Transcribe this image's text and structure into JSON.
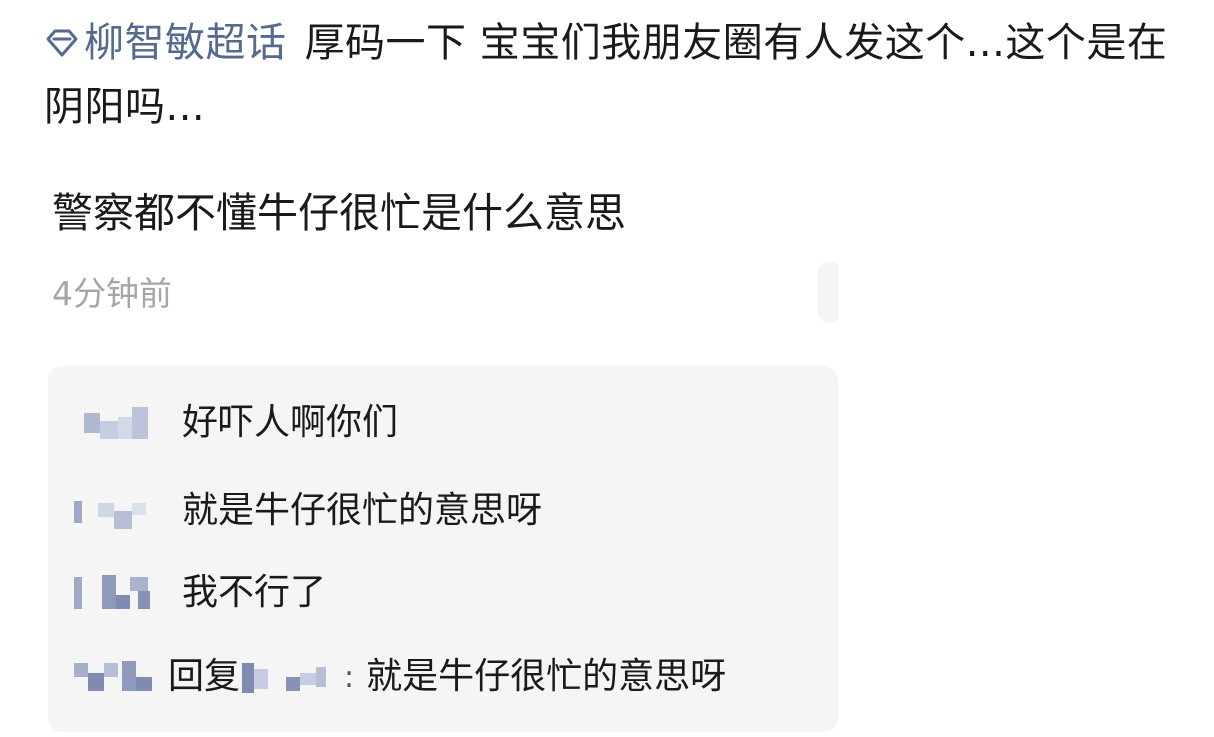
{
  "post": {
    "topic_tag": "柳智敏超话",
    "body": "厚码一下 宝宝们我朋友圈有人发这个...这个是在阴阳吗..."
  },
  "screenshot": {
    "main_text": "警察都不懂牛仔很忙是什么意思",
    "timestamp": "4分钟前",
    "comments": [
      {
        "text": "好吓人啊你们"
      },
      {
        "text": "就是牛仔很忙的意思呀"
      },
      {
        "text": "我不行了"
      },
      {
        "reply_label": "回复",
        "separator": ":",
        "text": "就是牛仔很忙的意思呀"
      }
    ]
  },
  "colors": {
    "topic_tag": "#56698f",
    "panel_bg": "#f5f5f6",
    "timestamp": "#a6a6a6",
    "blur_pixels": "#aeb8d0"
  },
  "icons": {
    "topic_icon": "diamond-topic-icon"
  }
}
